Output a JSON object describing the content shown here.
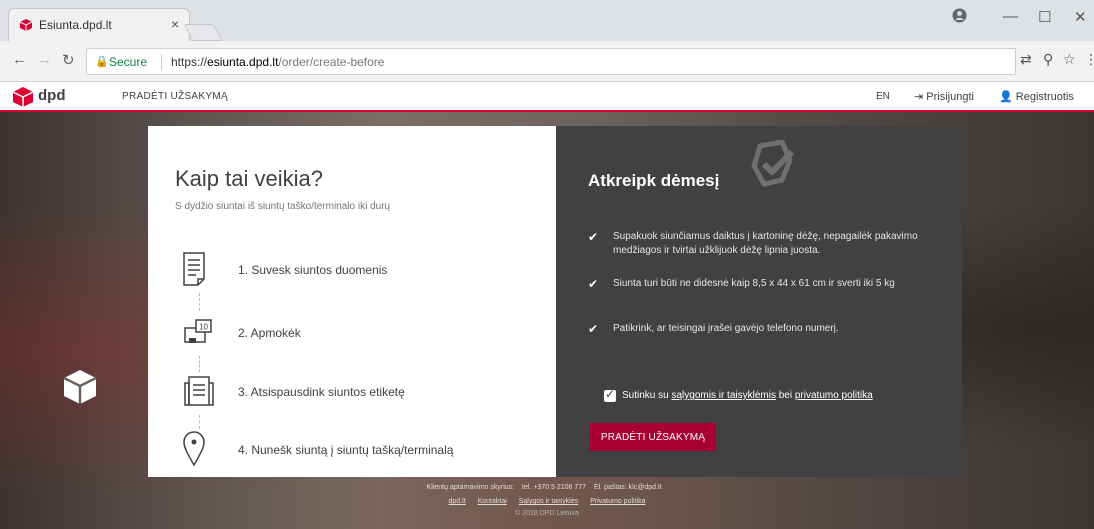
{
  "browser": {
    "tab_title": "Esiunta.dpd.lt",
    "secure_label": "Secure",
    "url_scheme": "https://",
    "url_host": "esiunta.dpd.lt",
    "url_path": "/order/create-before"
  },
  "header": {
    "logo_text": "dpd",
    "nav_start": "PRADĖTI UŽSAKYMĄ",
    "lang": "EN",
    "login": "Prisijungti",
    "register": "Registruotis"
  },
  "how_it_works": {
    "title": "Kaip tai veikia?",
    "subtitle": "S dydžio siuntai iš siuntų taško/terminalo iki durų",
    "steps": [
      {
        "label": "1. Suvesk siuntos duomenis",
        "icon": "document-icon"
      },
      {
        "label": "2. Apmokėk",
        "icon": "payment-icon"
      },
      {
        "label": "3. Atsispausdink siuntos etiketę",
        "icon": "printer-icon"
      },
      {
        "label": "4. Nunešk siuntą į siuntų tašką/terminalą",
        "icon": "location-pin-icon"
      }
    ],
    "payment_icon_value": "10"
  },
  "attention": {
    "title": "Atkreipk dėmesį",
    "notes": [
      "Supakuok siunčiamus daiktus į kartoninę dėžę, nepagailėk pakavimo medžiagos ir tvirtai užklijuok dėžę lipnia juosta.",
      "Siunta turi būti ne didesnė kaip 8,5 x 44 x 61 cm ir sverti iki 5 kg",
      "Patikrink, ar teisingai įrašei gavėjo telefono numerį."
    ],
    "agree_prefix": "Sutinku su",
    "agree_link1": "sąlygomis ir taisyklėmis",
    "agree_mid": "bei",
    "agree_link2": "privatumo politika",
    "agree_checked": true,
    "cta": "PRADĖTI UŽSAKYMĄ"
  },
  "footer": {
    "service_label": "Klientų aptarnavimo skyrius:",
    "phone": "tel. +370 5 2106 777",
    "email": "El. paštas: klc@dpd.lt",
    "links": [
      "dpd.lt",
      "Kontaktai",
      "Sąlygos ir taisyklės",
      "Privatumo politika"
    ],
    "copyright": "© 2018 DPD Lietuva"
  },
  "colors": {
    "brand_red": "#dc0032",
    "cta_red": "#a90034",
    "dark_panel": "#414042",
    "secure_green": "#0b8043"
  }
}
